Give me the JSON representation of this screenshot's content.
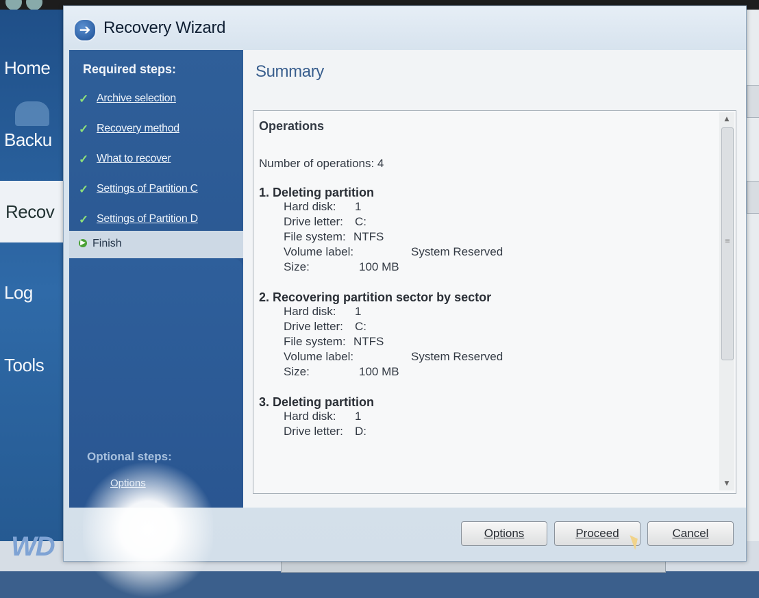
{
  "background_app": {
    "nav": [
      "Home",
      "Backu",
      "Recov",
      "Log",
      "Tools"
    ],
    "logo": "WD"
  },
  "wizard": {
    "title": "Recovery Wizard",
    "required_heading": "Required steps:",
    "steps": [
      {
        "label": "Archive selection",
        "status": "done"
      },
      {
        "label": "Recovery method",
        "status": "done"
      },
      {
        "label": "What to recover",
        "status": "done"
      },
      {
        "label": "Settings of Partition C",
        "status": "done"
      },
      {
        "label": "Settings of Partition D",
        "status": "done"
      }
    ],
    "current_step": "Finish",
    "optional_heading": "Optional steps:",
    "optional_item": "Options"
  },
  "summary": {
    "title": "Summary",
    "ops_heading": "Operations",
    "num_ops": "Number of operations: 4",
    "operations": [
      {
        "title": "1. Deleting partition",
        "hard_disk_label": "Hard disk:",
        "hard_disk": "1",
        "drive_letter_label": "Drive letter:",
        "drive_letter": "C:",
        "fs_label": "File system:",
        "fs": "NTFS",
        "volume_label_label": "Volume label:",
        "volume_label": "System Reserved",
        "size_label": "Size:",
        "size": "100 MB"
      },
      {
        "title": "2. Recovering partition sector by sector",
        "hard_disk_label": "Hard disk:",
        "hard_disk": "1",
        "drive_letter_label": "Drive letter:",
        "drive_letter": "C:",
        "fs_label": "File system:",
        "fs": "NTFS",
        "volume_label_label": "Volume label:",
        "volume_label": "System Reserved",
        "size_label": "Size:",
        "size": "100 MB"
      },
      {
        "title": "3. Deleting partition",
        "hard_disk_label": "Hard disk:",
        "hard_disk": "1",
        "drive_letter_label": "Drive letter:",
        "drive_letter": "D:"
      }
    ]
  },
  "buttons": {
    "options": "Options",
    "proceed": "Proceed",
    "cancel": "Cancel"
  }
}
